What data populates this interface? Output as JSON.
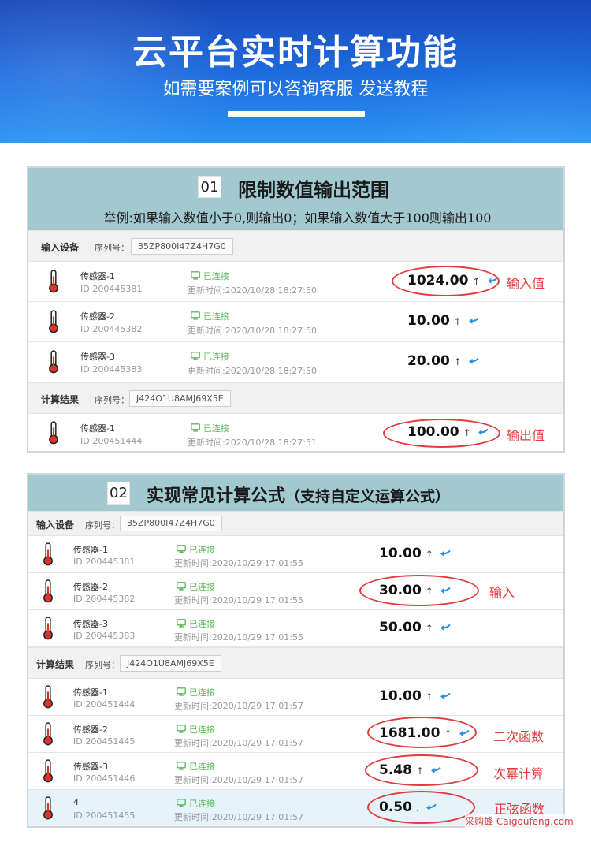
{
  "header": {
    "title": "云平台实时计算功能",
    "subtitle": "如需要案例可以咨询客服 发送教程"
  },
  "panel1": {
    "number": "01",
    "title": "限制数值输出范围",
    "description": "举例:如果输入数值小于0,则输出0；如果输入数值大于100则输出100",
    "input_section": {
      "label": "输入设备",
      "serial_label": "序列号：",
      "serial": "35ZP800I47Z4H7G0"
    },
    "input_rows": [
      {
        "name": "传感器-1",
        "id": "ID:200445381",
        "status": "已连接",
        "time": "更新时间:2020/10/28 18:27:50",
        "value": "1024.00",
        "arrow": "↑"
      },
      {
        "name": "传感器-2",
        "id": "ID:200445382",
        "status": "已连接",
        "time": "更新时间:2020/10/28 18:27:50",
        "value": "10.00",
        "arrow": "↑"
      },
      {
        "name": "传感器-3",
        "id": "ID:200445383",
        "status": "已连接",
        "time": "更新时间:2020/10/28 18:27:50",
        "value": "20.00",
        "arrow": "↑"
      }
    ],
    "result_section": {
      "label": "计算结果",
      "serial_label": "序列号：",
      "serial": "J424O1U8AMJ69X5E"
    },
    "result_rows": [
      {
        "name": "传感器-1",
        "id": "ID:200451444",
        "status": "已连接",
        "time": "更新时间:2020/10/28 18:27:51",
        "value": "100.00",
        "arrow": "↑"
      }
    ],
    "annotations": {
      "input": "输入值",
      "output": "输出值"
    }
  },
  "panel2": {
    "number": "02",
    "title": "实现常见计算公式",
    "title_suffix": "（支持自定义运算公式）",
    "input_section": {
      "label": "输入设备",
      "serial_label": "序列号：",
      "serial": "35ZP800I47Z4H7G0"
    },
    "input_rows": [
      {
        "name": "传感器-1",
        "id": "ID:200445381",
        "status": "已连接",
        "time": "更新时间:2020/10/29 17:01:55",
        "value": "10.00",
        "arrow": "↑"
      },
      {
        "name": "传感器-2",
        "id": "ID:200445382",
        "status": "已连接",
        "time": "更新时间:2020/10/29 17:01:55",
        "value": "30.00",
        "arrow": "↑"
      },
      {
        "name": "传感器-3",
        "id": "ID:200445383",
        "status": "已连接",
        "time": "更新时间:2020/10/29 17:01:55",
        "value": "50.00",
        "arrow": "↑"
      }
    ],
    "result_section": {
      "label": "计算结果",
      "serial_label": "序列号：",
      "serial": "J424O1U8AMJ69X5E"
    },
    "result_rows": [
      {
        "name": "传感器-1",
        "id": "ID:200451444",
        "status": "已连接",
        "time": "更新时间:2020/10/29 17:01:57",
        "value": "10.00",
        "arrow": "↑"
      },
      {
        "name": "传感器-2",
        "id": "ID:200451445",
        "status": "已连接",
        "time": "更新时间:2020/10/29 17:01:57",
        "value": "1681.00",
        "arrow": "↑"
      },
      {
        "name": "传感器-3",
        "id": "ID:200451446",
        "status": "已连接",
        "time": "更新时间:2020/10/29 17:01:57",
        "value": "5.48",
        "arrow": "↑"
      },
      {
        "name": "4",
        "id": "ID:200451455",
        "status": "已连接",
        "time": "更新时间:2020/10/29 17:01:57",
        "value": "0.50",
        "arrow": "."
      }
    ],
    "annotations": {
      "input": "输入",
      "square": "二次函数",
      "power": "次幂计算",
      "sine": "正弦函数"
    }
  },
  "watermark": "采购蜂 Caigoufeng.com",
  "colors": {
    "header_top": "#1a48b8",
    "header_bottom": "#2b95f2",
    "panel_head": "#a3c9d0",
    "status_green": "#5cb85c",
    "annotation_red": "#e23b3b",
    "back_arrow_blue": "#2a8ee0"
  }
}
